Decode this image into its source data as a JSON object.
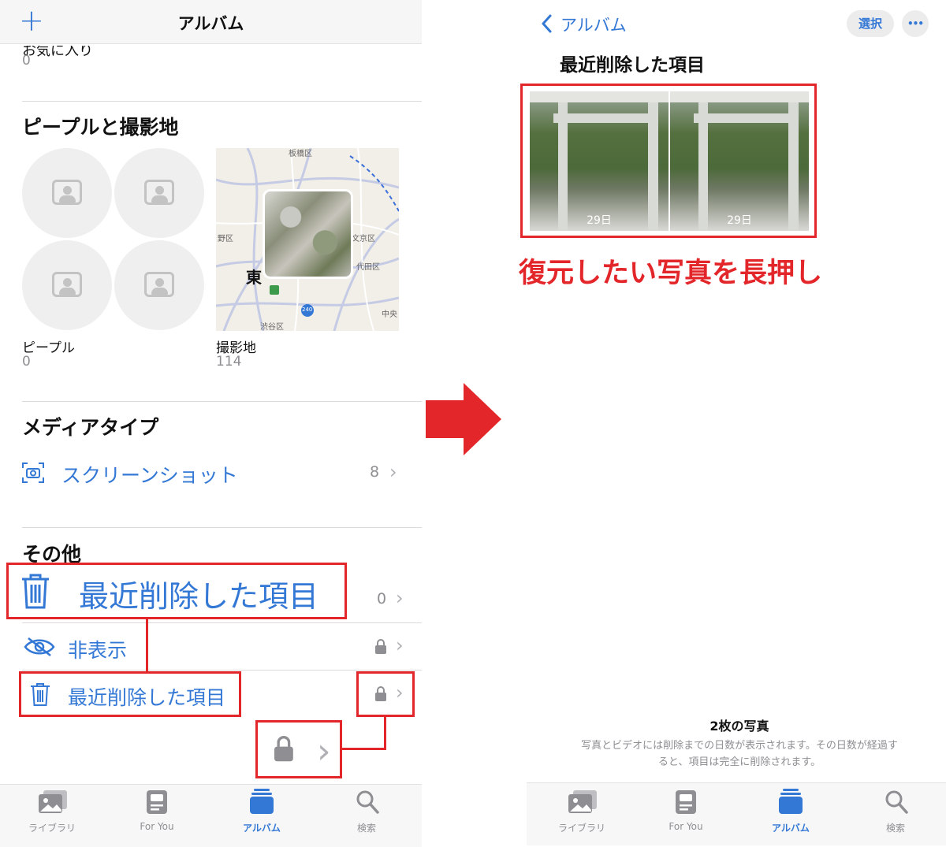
{
  "left": {
    "nav": {
      "title": "アルバム",
      "add_symbol": "+"
    },
    "favorites": {
      "label": "お気に入り",
      "count": "0"
    },
    "people_places": {
      "heading": "ピープルと撮影地",
      "people_label": "ピープル",
      "people_count": "0",
      "places_label": "撮影地",
      "places_count": "114",
      "map_labels": [
        "板橋区",
        "野区",
        "文京区",
        "代田区",
        "東",
        "渋谷区",
        "中央",
        "240"
      ]
    },
    "media_types": {
      "heading": "メディアタイプ",
      "screenshots_label": "スクリーンショット",
      "screenshots_count": "8"
    },
    "other": {
      "heading": "その他",
      "recently_deleted_large": "最近削除した項目",
      "recently_deleted_large_count": "0",
      "hidden_label": "非表示",
      "recently_deleted_label": "最近削除した項目"
    },
    "tabs": [
      {
        "label": "ライブラリ",
        "icon": "photos-icon"
      },
      {
        "label": "For You",
        "icon": "for-you-icon"
      },
      {
        "label": "アルバム",
        "icon": "albums-icon"
      },
      {
        "label": "検索",
        "icon": "search-icon"
      }
    ]
  },
  "right": {
    "nav": {
      "back_label": "アルバム",
      "select_label": "選択",
      "more_symbol": "•••"
    },
    "title": "最近削除した項目",
    "photos": [
      {
        "days": "29日"
      },
      {
        "days": "29日"
      }
    ],
    "annotation": "復元したい写真を長押し",
    "footer": {
      "count": "2枚の写真",
      "note_line1": "写真とビデオには削除までの日数が表示されます。その日数が経過す",
      "note_line2": "ると、項目は完全に削除されます。"
    },
    "tabs": [
      {
        "label": "ライブラリ",
        "icon": "photos-icon"
      },
      {
        "label": "For You",
        "icon": "for-you-icon"
      },
      {
        "label": "アルバム",
        "icon": "albums-icon"
      },
      {
        "label": "検索",
        "icon": "search-icon"
      }
    ]
  },
  "colors": {
    "accent": "#3478d6",
    "annotation_red": "#e3262a",
    "secondary": "#8e8e93"
  }
}
